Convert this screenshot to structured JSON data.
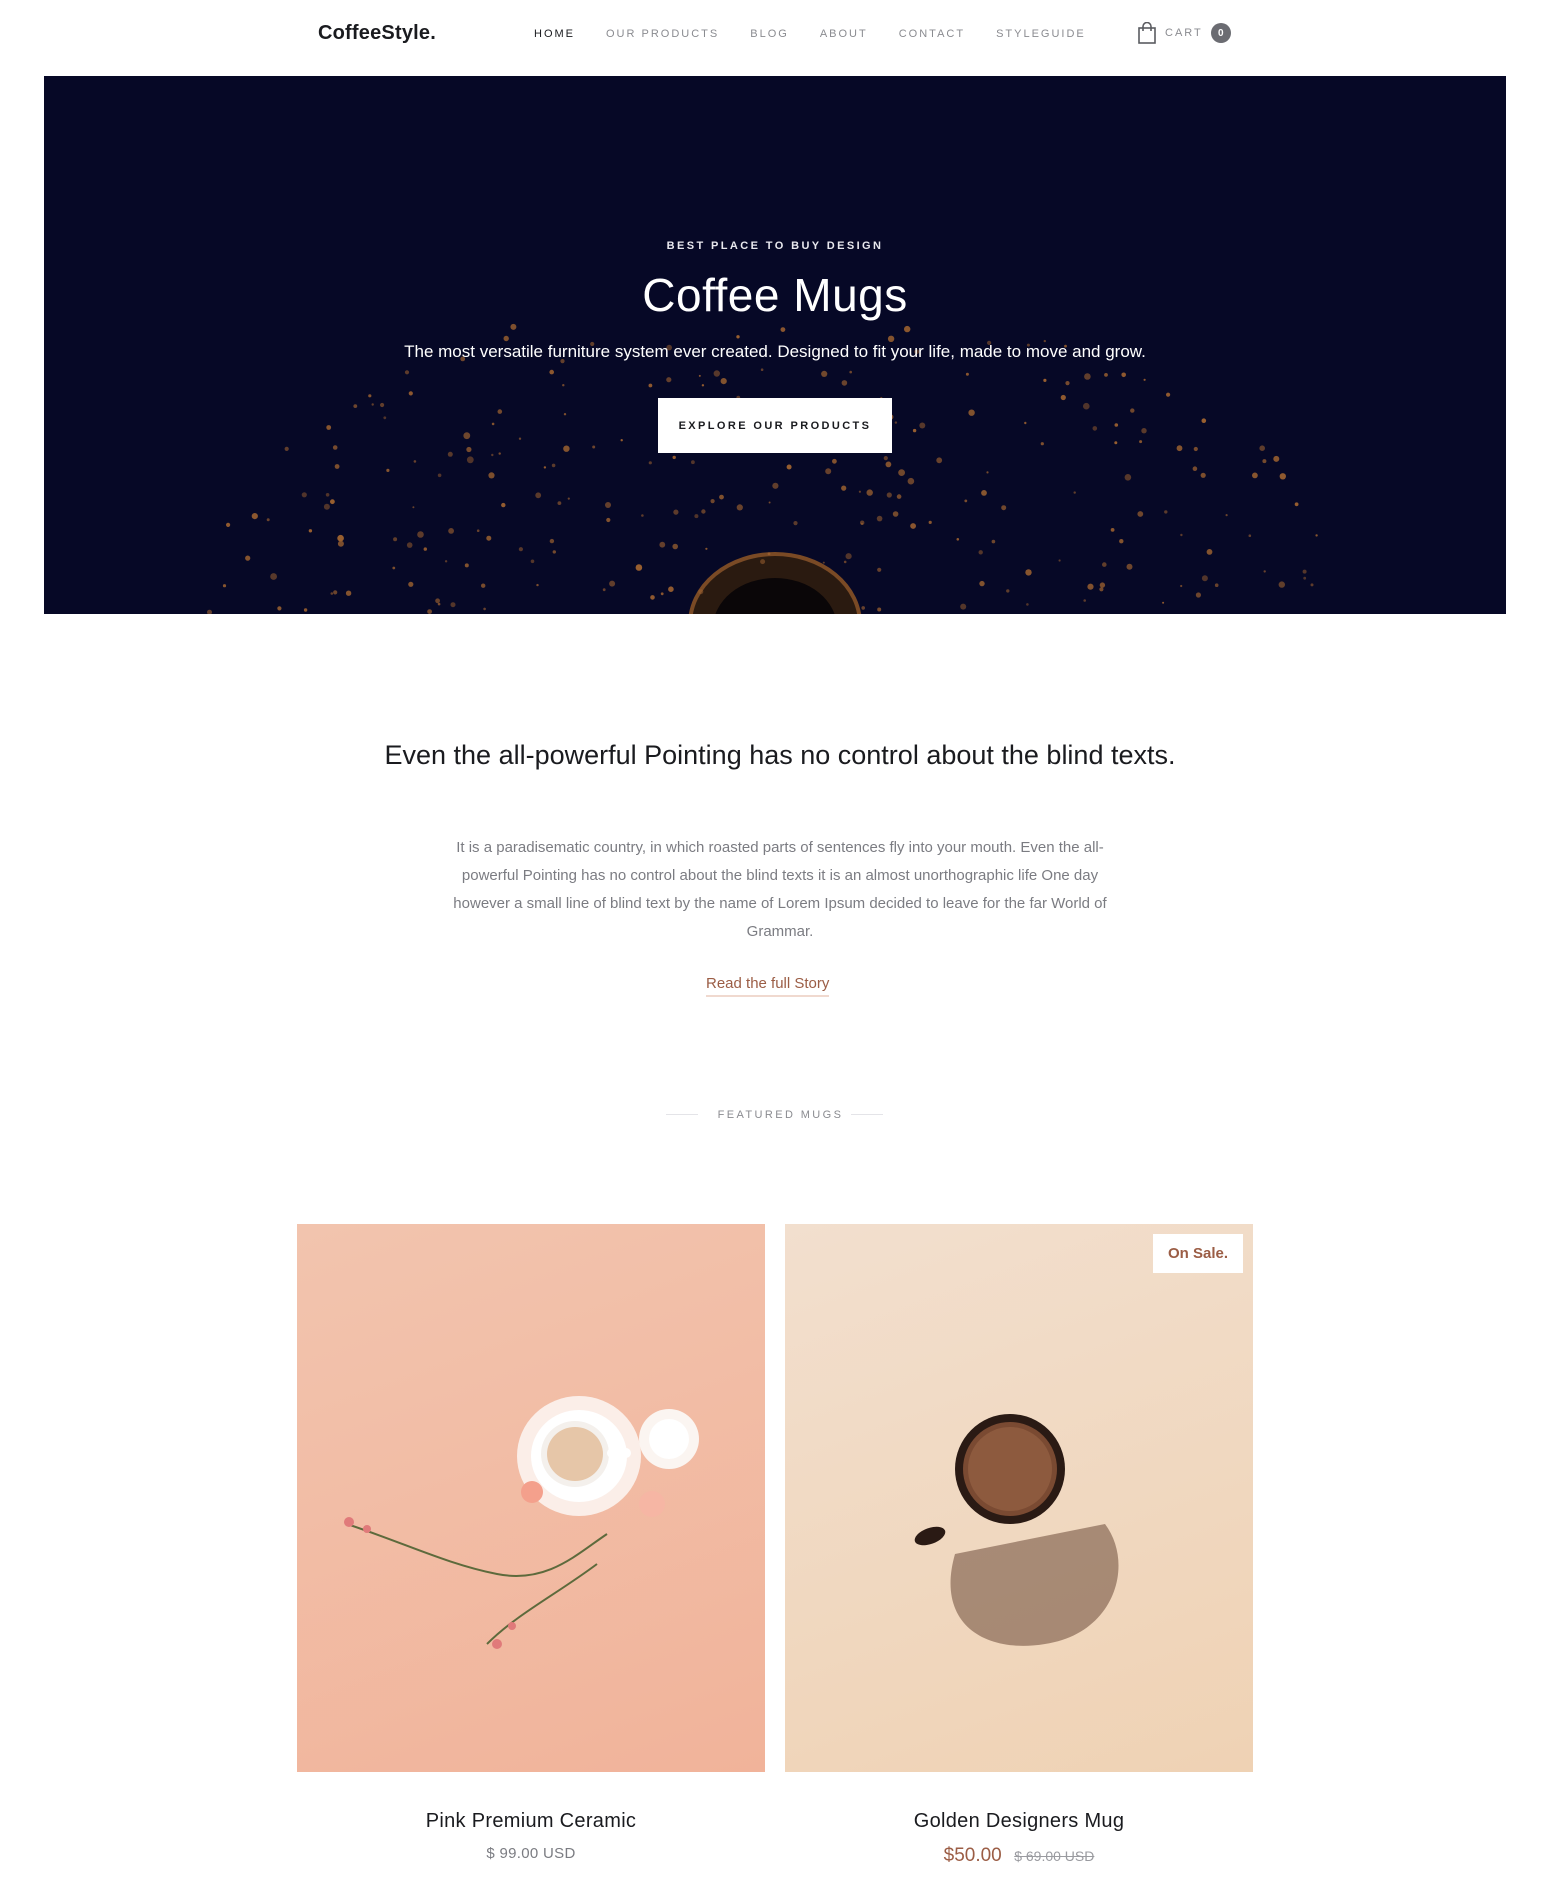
{
  "nav": {
    "brand": "CoffeeStyle.",
    "items": [
      {
        "label": "HOME",
        "active": true
      },
      {
        "label": "OUR PRODUCTS",
        "active": false
      },
      {
        "label": "BLOG",
        "active": false
      },
      {
        "label": "ABOUT",
        "active": false
      },
      {
        "label": "CONTACT",
        "active": false
      },
      {
        "label": "STYLEGUIDE",
        "active": false
      }
    ],
    "cart_label": "CART",
    "cart_count": "0",
    "cart_icon": "shopping-bag-icon"
  },
  "hero": {
    "eyebrow": "BEST PLACE TO BUY DESIGN",
    "title": "Coffee Mugs",
    "subtitle": "The most versatile furniture system ever created. Designed to fit your life, made to move and grow.",
    "button": "EXPLORE OUR PRODUCTS",
    "background_color": "#060826"
  },
  "story": {
    "heading": "Even the all-powerful Pointing has no control about the blind texts.",
    "body": "It is a paradisematic country, in which roasted parts of sentences fly into your mouth. Even the all-powerful Pointing has no control about the blind texts it is an almost unorthographic life One day however a small line of blind text by the name of Lorem Ipsum decided to leave for the far World of Grammar.",
    "link": "Read the full Story"
  },
  "featured": {
    "label": "FEATURED MUGS"
  },
  "products": [
    {
      "name": "Pink Premium Ceramic",
      "price": "$ 99.00 USD",
      "image_bg": "#f3bfa8"
    },
    {
      "name": "Golden Designers Mug",
      "badge": "On Sale.",
      "sale_price": "$50.00",
      "old_price": "$ 69.00 USD",
      "image_bg": "#f0d8c0"
    }
  ],
  "colors": {
    "accent": "#9b5d45",
    "text": "#1a1b1f",
    "muted": "#7b7c82"
  }
}
